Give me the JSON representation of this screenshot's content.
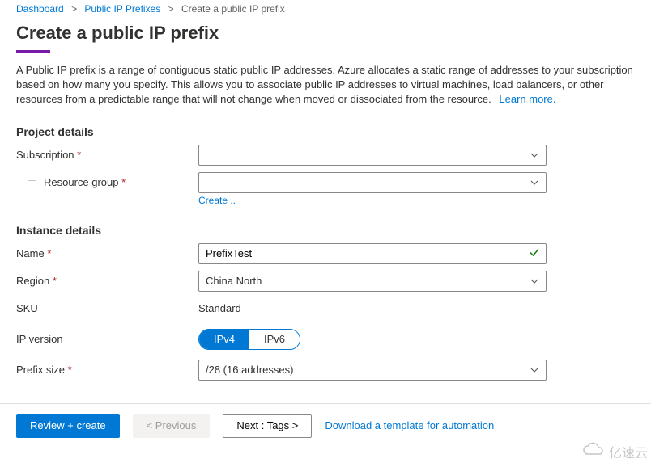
{
  "breadcrumb": {
    "items": [
      {
        "label": "Dashboard",
        "link": true
      },
      {
        "label": "Public IP Prefixes",
        "link": true
      },
      {
        "label": "Create a public IP prefix",
        "link": false
      }
    ]
  },
  "page": {
    "title": "Create a public IP prefix"
  },
  "intro": {
    "text": "A Public IP prefix is a range of contiguous static public IP addresses. Azure allocates a static range of addresses to your subscription based on how many you specify. This allows you to associate public IP addresses to virtual machines, load balancers, or other resources from a predictable range that will not change when moved or dissociated from the resource.",
    "learn_more": "Learn more."
  },
  "sections": {
    "project_details": "Project details",
    "instance_details": "Instance details"
  },
  "fields": {
    "subscription": {
      "label": "Subscription",
      "value": ""
    },
    "resource_group": {
      "label": "Resource group",
      "value": "",
      "create_new": "Create .."
    },
    "name": {
      "label": "Name",
      "value": "PrefixTest"
    },
    "region": {
      "label": "Region",
      "value": "China North"
    },
    "sku": {
      "label": "SKU",
      "value": "Standard"
    },
    "ip_version": {
      "label": "IP version",
      "options": [
        "IPv4",
        "IPv6"
      ],
      "selected": "IPv4"
    },
    "prefix_size": {
      "label": "Prefix size",
      "value": "/28 (16 addresses)"
    }
  },
  "footer": {
    "review_create": "Review + create",
    "previous": "< Previous",
    "next": "Next : Tags >",
    "download": "Download a template for automation"
  },
  "watermark": "亿速云"
}
